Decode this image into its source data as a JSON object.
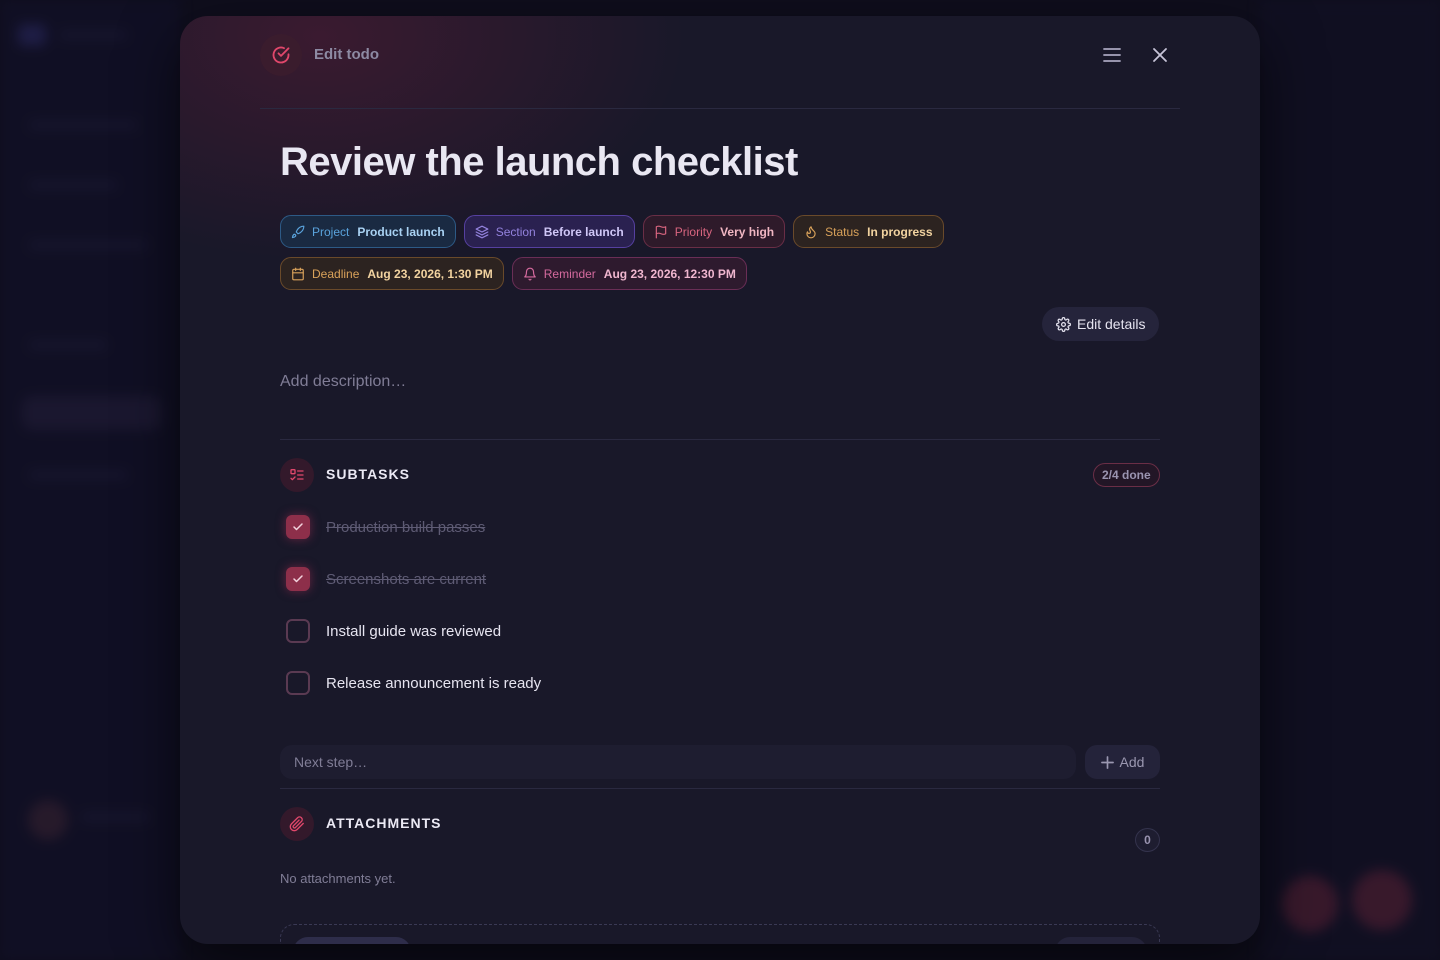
{
  "header": {
    "title": "Edit todo",
    "menu_icon": "menu-icon",
    "close_icon": "close-icon"
  },
  "todo": {
    "title": "Review the launch checklist"
  },
  "chips": {
    "project": {
      "label": "Project",
      "value": "Product launch",
      "icon": "rocket-icon"
    },
    "section": {
      "label": "Section",
      "value": "Before launch",
      "icon": "layers-icon"
    },
    "priority": {
      "label": "Priority",
      "value": "Very high",
      "icon": "flag-icon"
    },
    "status": {
      "label": "Status",
      "value": "In progress",
      "icon": "flame-icon"
    },
    "deadline": {
      "label": "Deadline",
      "value": "Aug 23, 2026, 1:30 PM",
      "icon": "calendar-icon"
    },
    "reminder": {
      "label": "Reminder",
      "value": "Aug 23, 2026, 12:30 PM",
      "icon": "bell-icon"
    }
  },
  "edit_details": {
    "label": "Edit details",
    "icon": "gear-icon"
  },
  "description": {
    "placeholder": "Add description…"
  },
  "subtasks": {
    "title": "SUBTASKS",
    "count": "2/4 done",
    "items": [
      {
        "text": "Production build passes",
        "done": true
      },
      {
        "text": "Screenshots are current",
        "done": true
      },
      {
        "text": "Install guide was reviewed",
        "done": false
      },
      {
        "text": "Release announcement is ready",
        "done": false
      }
    ],
    "input_placeholder": "Next step…",
    "add_label": "Add"
  },
  "attachments": {
    "title": "ATTACHMENTS",
    "count": "0",
    "empty_text": "No attachments yet."
  },
  "colors": {
    "accent": "#e0476b",
    "modal_bg": "#191829",
    "page_bg": "#0f0e1d"
  }
}
